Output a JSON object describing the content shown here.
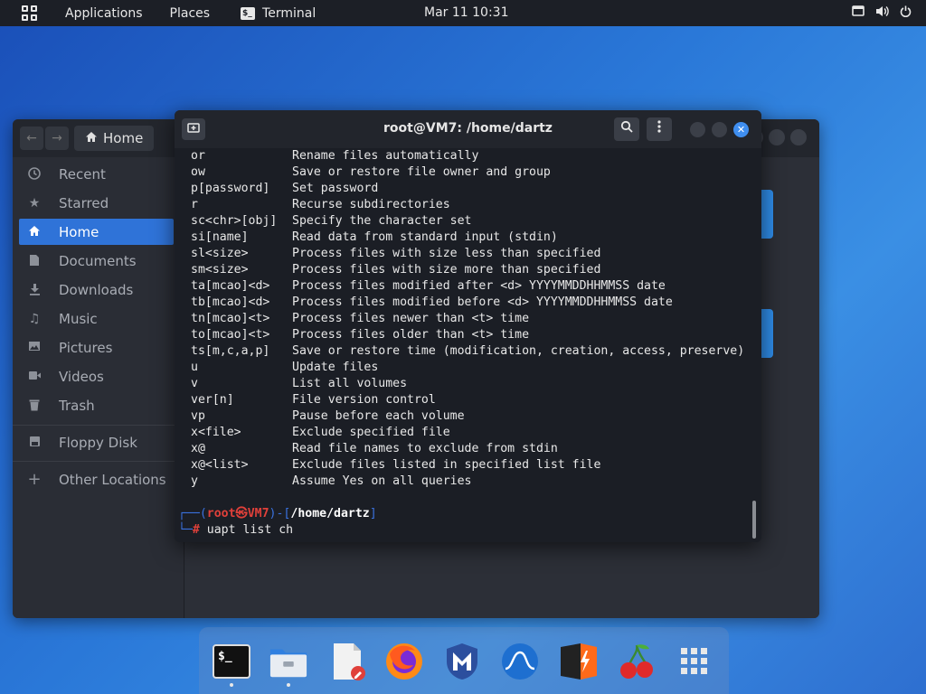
{
  "topbar": {
    "applications": "Applications",
    "places": "Places",
    "terminal_app": "Terminal",
    "clock": "Mar 11  10:31"
  },
  "files": {
    "path": "Home",
    "sidebar": [
      {
        "label": "Recent",
        "icon": "clock-icon"
      },
      {
        "label": "Starred",
        "icon": "star-icon"
      },
      {
        "label": "Home",
        "icon": "home-icon"
      },
      {
        "label": "Documents",
        "icon": "document-icon"
      },
      {
        "label": "Downloads",
        "icon": "download-icon"
      },
      {
        "label": "Music",
        "icon": "music-icon"
      },
      {
        "label": "Pictures",
        "icon": "pictures-icon"
      },
      {
        "label": "Videos",
        "icon": "video-icon"
      },
      {
        "label": "Trash",
        "icon": "trash-icon"
      },
      {
        "label": "Floppy Disk",
        "icon": "floppy-icon"
      },
      {
        "label": "Other Locations",
        "icon": "plus-icon"
      }
    ]
  },
  "terminal": {
    "title": "root@VM7: /home/dartz",
    "lines": [
      {
        "opt": "or",
        "desc": "Rename files automatically"
      },
      {
        "opt": "ow",
        "desc": "Save or restore file owner and group"
      },
      {
        "opt": "p[password]",
        "desc": "Set password"
      },
      {
        "opt": "r",
        "desc": "Recurse subdirectories"
      },
      {
        "opt": "sc<chr>[obj]",
        "desc": "Specify the character set"
      },
      {
        "opt": "si[name]",
        "desc": "Read data from standard input (stdin)"
      },
      {
        "opt": "sl<size>",
        "desc": "Process files with size less than specified"
      },
      {
        "opt": "sm<size>",
        "desc": "Process files with size more than specified"
      },
      {
        "opt": "ta[mcao]<d>",
        "desc": "Process files modified after <d> YYYYMMDDHHMMSS date"
      },
      {
        "opt": "tb[mcao]<d>",
        "desc": "Process files modified before <d> YYYYMMDDHHMMSS date"
      },
      {
        "opt": "tn[mcao]<t>",
        "desc": "Process files newer than <t> time"
      },
      {
        "opt": "to[mcao]<t>",
        "desc": "Process files older than <t> time"
      },
      {
        "opt": "ts[m,c,a,p]",
        "desc": "Save or restore time (modification, creation, access, preserve)"
      },
      {
        "opt": "u",
        "desc": "Update files"
      },
      {
        "opt": "v",
        "desc": "List all volumes"
      },
      {
        "opt": "ver[n]",
        "desc": "File version control"
      },
      {
        "opt": "vp",
        "desc": "Pause before each volume"
      },
      {
        "opt": "x<file>",
        "desc": "Exclude specified file"
      },
      {
        "opt": "x@",
        "desc": "Read file names to exclude from stdin"
      },
      {
        "opt": "x@<list>",
        "desc": "Exclude files listed in specified list file"
      },
      {
        "opt": "y",
        "desc": "Assume Yes on all queries"
      }
    ],
    "prompt": {
      "user": "root",
      "at": "㉿",
      "host": "VM7",
      "path": "/home/dartz",
      "symbol": "#",
      "command": "uapt list ch"
    }
  },
  "dock": {
    "items": [
      "terminal-icon",
      "files-icon",
      "text-editor-icon",
      "firefox-icon",
      "metasploit-icon",
      "wireshark-icon",
      "burpsuite-icon",
      "cherrytree-icon",
      "show-apps-icon"
    ]
  },
  "colors": {
    "accent": "#2f73d8",
    "prompt_red": "#e0403a",
    "prompt_blue": "#3a72e0"
  }
}
